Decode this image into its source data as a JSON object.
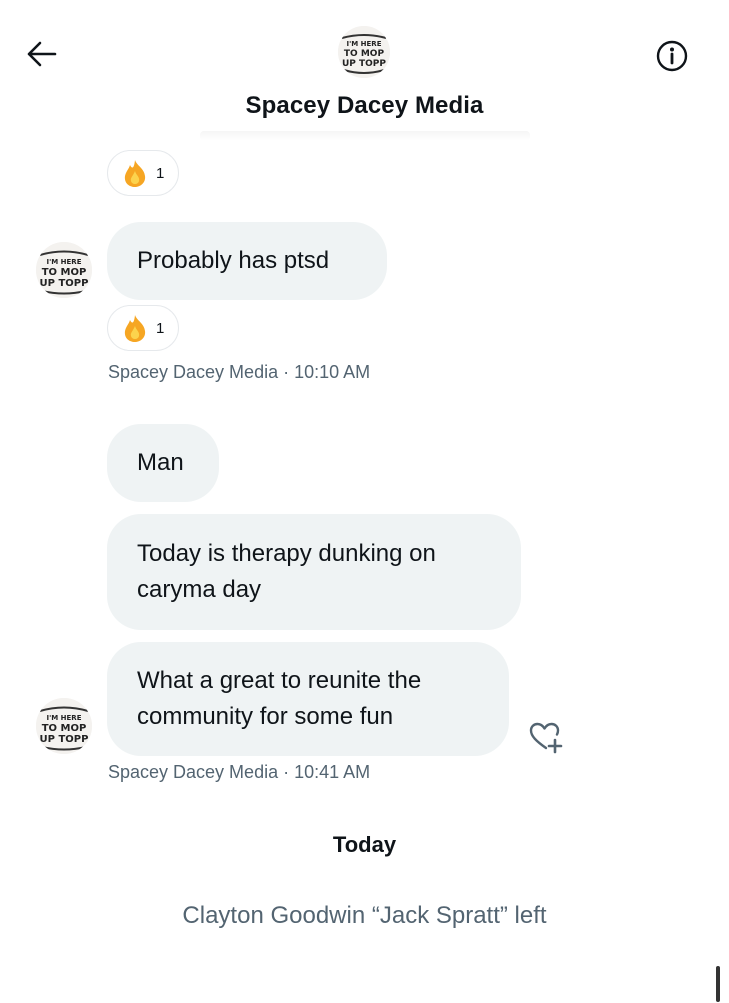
{
  "header": {
    "title": "Spacey Dacey Media",
    "back_icon": "arrow-left-icon",
    "info_icon": "info-circle-icon",
    "avatar_text": [
      "I'M HERE",
      "TO MOP",
      "UP TOPP"
    ]
  },
  "reactions": [
    {
      "emoji": "fire",
      "count": "1"
    },
    {
      "emoji": "fire",
      "count": "1"
    }
  ],
  "messages": [
    {
      "text": "Probably has ptsd"
    },
    {
      "text": "Man"
    },
    {
      "text": "Today is therapy dunking on caryma day"
    },
    {
      "text": "What a great to reunite the community for some fun"
    }
  ],
  "meta": [
    {
      "sender": "Spacey Dacey Media",
      "time": "10:10 AM"
    },
    {
      "sender": "Spacey Dacey Media",
      "time": "10:41 AM"
    }
  ],
  "divider": {
    "label": "Today"
  },
  "event": {
    "text": "Clayton Goodwin “Jack Spratt” left"
  },
  "colors": {
    "bubble": "#eff3f4",
    "meta_text": "#536471",
    "text": "#0f1419"
  }
}
